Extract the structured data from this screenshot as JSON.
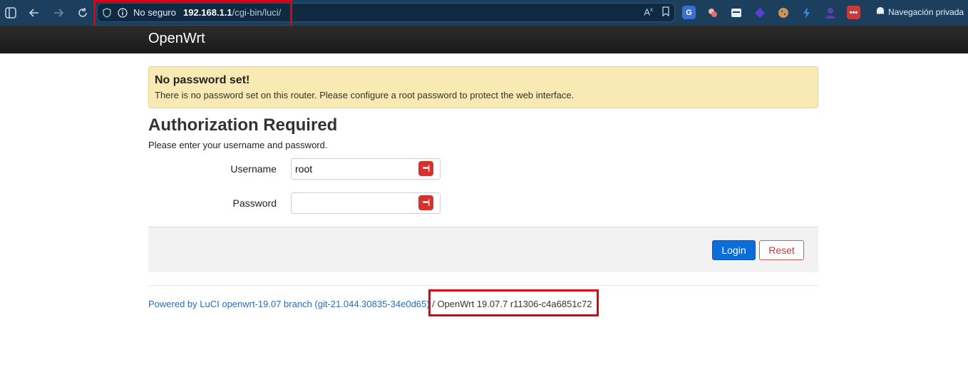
{
  "browser": {
    "address": {
      "security_label": "No seguro",
      "host": "192.168.1.1",
      "path": "/cgi-bin/luci/"
    },
    "private_label": "Navegación privada",
    "icons": [
      "sidebar-icon",
      "back-icon",
      "forward-icon",
      "reload-icon",
      "shield-icon",
      "info-icon",
      "translate-icon",
      "bookmark-icon"
    ]
  },
  "header": {
    "brand": "OpenWrt"
  },
  "alert": {
    "title": "No password set!",
    "text": "There is no password set on this router. Please configure a root password to protect the web interface."
  },
  "auth": {
    "title": "Authorization Required",
    "description": "Please enter your username and password.",
    "username_label": "Username",
    "username_value": "root",
    "password_label": "Password",
    "password_value": ""
  },
  "actions": {
    "login_label": "Login",
    "reset_label": "Reset"
  },
  "footer": {
    "powered_link": "Powered by LuCI openwrt-19.07 branch (git-21.044.30835-34e0d65)",
    "version_text": " / OpenWrt 19.07.7 r11306-c4a6851c72"
  },
  "colors": {
    "browser_bar": "#1c3f5e",
    "header_bg": "#222222",
    "alert_bg": "#f8eab2",
    "login_button": "#0a6dd9",
    "reset_border": "#d45a57",
    "highlight_box": "#e0000f",
    "link": "#2a6cc4"
  }
}
